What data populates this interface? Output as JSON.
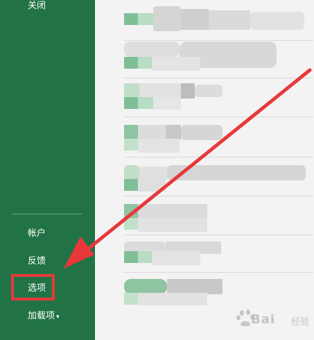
{
  "sidebar": {
    "items": [
      {
        "label": "关闭"
      },
      {
        "label": "帐户"
      },
      {
        "label": "反馈"
      },
      {
        "label": "选项"
      },
      {
        "label": "加载项"
      }
    ],
    "addin_arrow": "▾",
    "background": "#217346"
  },
  "annotation": {
    "highlight_color": "#e8383a",
    "arrow_color": "#e8383a"
  },
  "watermark": {
    "brand": "Bai",
    "sub": "经验"
  },
  "icons": [
    "chevron-down-icon",
    "red-arrow-annotation",
    "baidu-paw-icon"
  ]
}
